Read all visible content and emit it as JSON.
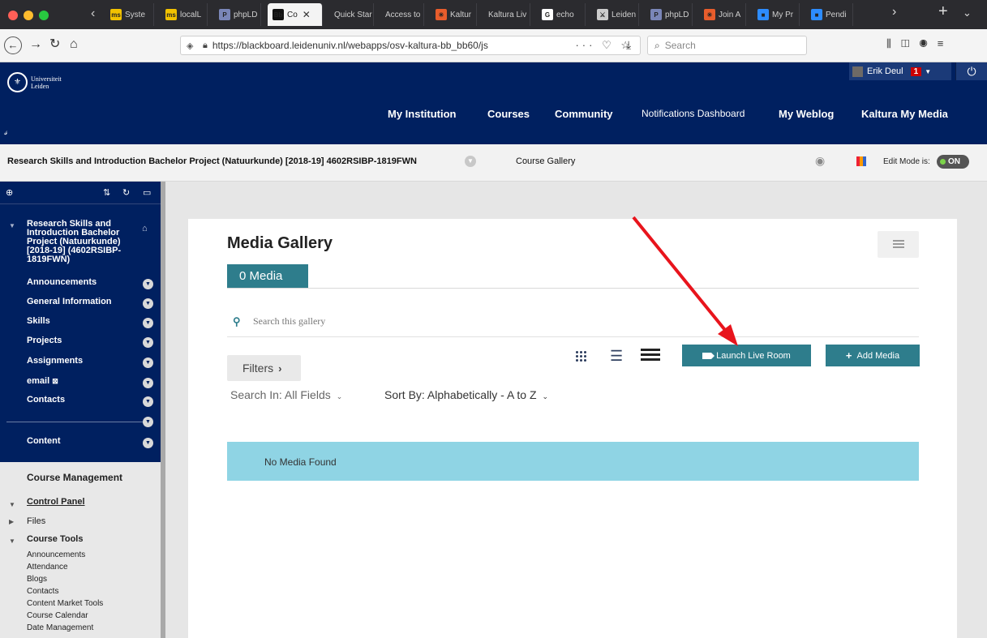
{
  "browser": {
    "tabs": [
      {
        "label": "Syste",
        "fav": "ms",
        "fav_color": "#f2c200"
      },
      {
        "label": "localL",
        "fav": "ms",
        "fav_color": "#f2c200"
      },
      {
        "label": "phpLD",
        "fav": "P",
        "fav_color": "#7a86b8"
      },
      {
        "label": "Co",
        "fav": "Bb",
        "fav_color": "#111111",
        "active": true
      },
      {
        "label": "Quick Star",
        "fav": "",
        "fav_color": ""
      },
      {
        "label": "Access to",
        "fav": "",
        "fav_color": ""
      },
      {
        "label": "Kaltur",
        "fav": "✳",
        "fav_color": "#e85d2c"
      },
      {
        "label": "Kaltura Liv",
        "fav": "",
        "fav_color": ""
      },
      {
        "label": "echo",
        "fav": "G",
        "fav_color": "#ffffff"
      },
      {
        "label": "Leiden",
        "fav": "⚔",
        "fav_color": "#cccccc"
      },
      {
        "label": "phpLD",
        "fav": "P",
        "fav_color": "#7a86b8"
      },
      {
        "label": "Join A",
        "fav": "✳",
        "fav_color": "#e85d2c"
      },
      {
        "label": "My Pr",
        "fav": "■",
        "fav_color": "#2d8cff"
      },
      {
        "label": "Pendi",
        "fav": "■",
        "fav_color": "#2d8cff"
      }
    ],
    "url": "https://blackboard.leidenuniv.nl/webapps/osv-kaltura-bb_bb60/js",
    "search_placeholder": "Search",
    "icons": [
      "back-icon",
      "forward-icon",
      "reload-icon",
      "home-icon",
      "shield-icon",
      "lock-icon",
      "more-icon",
      "pocket-icon",
      "star-icon",
      "download-icon",
      "library-icon",
      "sidebar-icon",
      "account-icon",
      "menu-icon"
    ]
  },
  "header": {
    "logo_line1": "Universiteit",
    "logo_line2": "Leiden",
    "user_name": "Erik Deul",
    "notification_count": "1",
    "nav": [
      {
        "label": "My Institution",
        "weight": "bold"
      },
      {
        "label": "Courses",
        "weight": "bold"
      },
      {
        "label": "Community",
        "weight": "bold"
      },
      {
        "label": "Notifications Dashboard",
        "weight": "normal"
      },
      {
        "label": "My Weblog",
        "weight": "bold"
      },
      {
        "label": "Kaltura My Media",
        "weight": "bold"
      }
    ]
  },
  "breadcrumb": {
    "course": "Research Skills and Introduction Bachelor Project (Natuurkunde) [2018-19] 4602RSIBP-1819FWN",
    "page": "Course Gallery",
    "edit_mode_label": "Edit Mode is:",
    "edit_mode_value": "ON"
  },
  "sidebar": {
    "course_title": "Research Skills and Introduction Bachelor Project (Natuurkunde) [2018-19] (4602RSIBP-1819FWN)",
    "items": [
      {
        "label": "Announcements"
      },
      {
        "label": "General Information"
      },
      {
        "label": "Skills"
      },
      {
        "label": "Projects"
      },
      {
        "label": "Assignments"
      },
      {
        "label": "email"
      },
      {
        "label": "Contacts"
      },
      {
        "label": "Content"
      }
    ],
    "course_management": "Course Management",
    "control_panel": "Control Panel",
    "files": "Files",
    "course_tools": "Course Tools",
    "course_tools_items": [
      "Announcements",
      "Attendance",
      "Blogs",
      "Contacts",
      "Content Market Tools",
      "Course Calendar",
      "Date Management"
    ]
  },
  "gallery": {
    "title": "Media Gallery",
    "media_tab": "0 Media",
    "search_placeholder": "Search this gallery",
    "filters_label": "Filters",
    "launch_label": "Launch Live Room",
    "add_label": "Add Media",
    "search_in": "Search In: All Fields",
    "sort_by": "Sort By: Alphabetically - A to Z",
    "empty_message": "No Media Found"
  },
  "colors": {
    "header_bg": "#002060",
    "teal": "#2e7d8c",
    "alert_bg": "#8fd4e4",
    "annotation_arrow": "#e8141c"
  }
}
